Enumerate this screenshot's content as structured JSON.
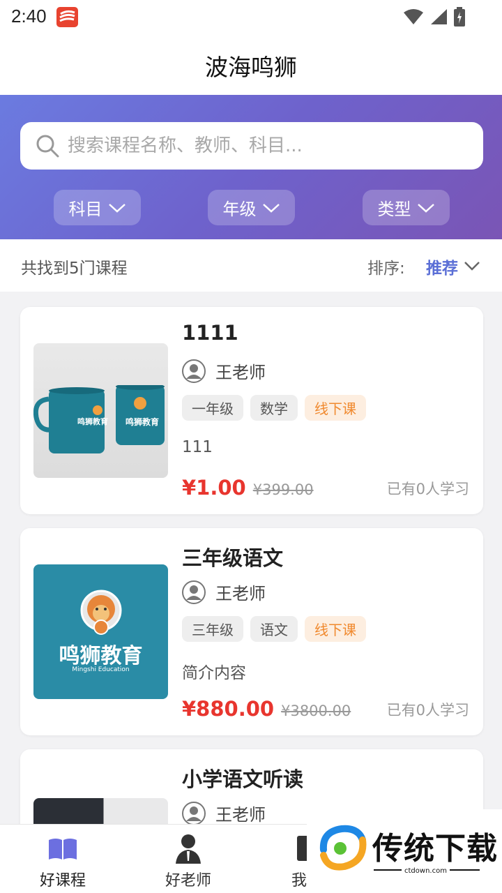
{
  "status": {
    "time": "2:40"
  },
  "header": {
    "title": "波海鸣狮"
  },
  "search": {
    "placeholder": "搜索课程名称、教师、科目..."
  },
  "filters": [
    {
      "label": "科目"
    },
    {
      "label": "年级"
    },
    {
      "label": "类型"
    }
  ],
  "results": {
    "count_text": "共找到5门课程",
    "sort_label": "排序:",
    "sort_value": "推荐"
  },
  "courses": [
    {
      "title": "1111",
      "teacher": "王老师",
      "tags": [
        "一年级",
        "数学",
        "线下课"
      ],
      "description": "111",
      "price": "¥1.00",
      "original_price": "¥399.00",
      "learners": "已有0人学习",
      "thumb_text": "鸣狮教育"
    },
    {
      "title": "三年级语文",
      "teacher": "王老师",
      "tags": [
        "三年级",
        "语文",
        "线下课"
      ],
      "description": "简介内容",
      "price": "¥880.00",
      "original_price": "¥3800.00",
      "learners": "已有0人学习",
      "thumb_text": "鸣狮教育",
      "thumb_subtext": "Mingshi Education"
    },
    {
      "title": "小学语文听读",
      "teacher": "王老师"
    }
  ],
  "nav": [
    {
      "label": "好课程",
      "active": true
    },
    {
      "label": "好老师",
      "active": false
    },
    {
      "label": "我的",
      "active": false
    }
  ],
  "watermark": {
    "text": "传统下载",
    "url": "ctdown.com"
  },
  "colors": {
    "accent": "#5b6fd6",
    "price": "#e8352e",
    "offline_tag": "#f0892e"
  }
}
